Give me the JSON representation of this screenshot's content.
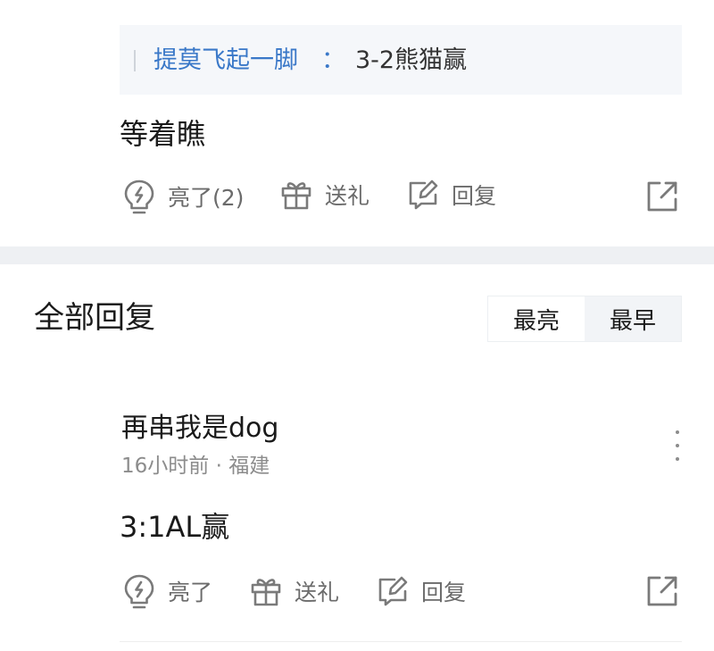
{
  "quote": {
    "author": "提莫飞起一脚",
    "colon": "：",
    "text": "3-2熊猫赢"
  },
  "top_comment": {
    "text": "等着瞧",
    "like_label": "亮了(2)",
    "gift_label": "送礼",
    "reply_label": "回复"
  },
  "section": {
    "title": "全部回复",
    "sort_options": [
      "最亮",
      "最早"
    ],
    "active_sort": "最早"
  },
  "reply": {
    "username": "再串我是dog",
    "meta": "16小时前 · 福建",
    "text": "3:1AL赢",
    "like_label": "亮了",
    "gift_label": "送礼",
    "reply_label": "回复"
  },
  "colors": {
    "quote_author": "#3a78c8",
    "icon_gray": "#7a7a7a",
    "divider": "#eef0f3"
  },
  "icons": [
    "lightbulb-icon",
    "gift-icon",
    "edit-icon",
    "share-icon",
    "more-vertical-icon"
  ]
}
